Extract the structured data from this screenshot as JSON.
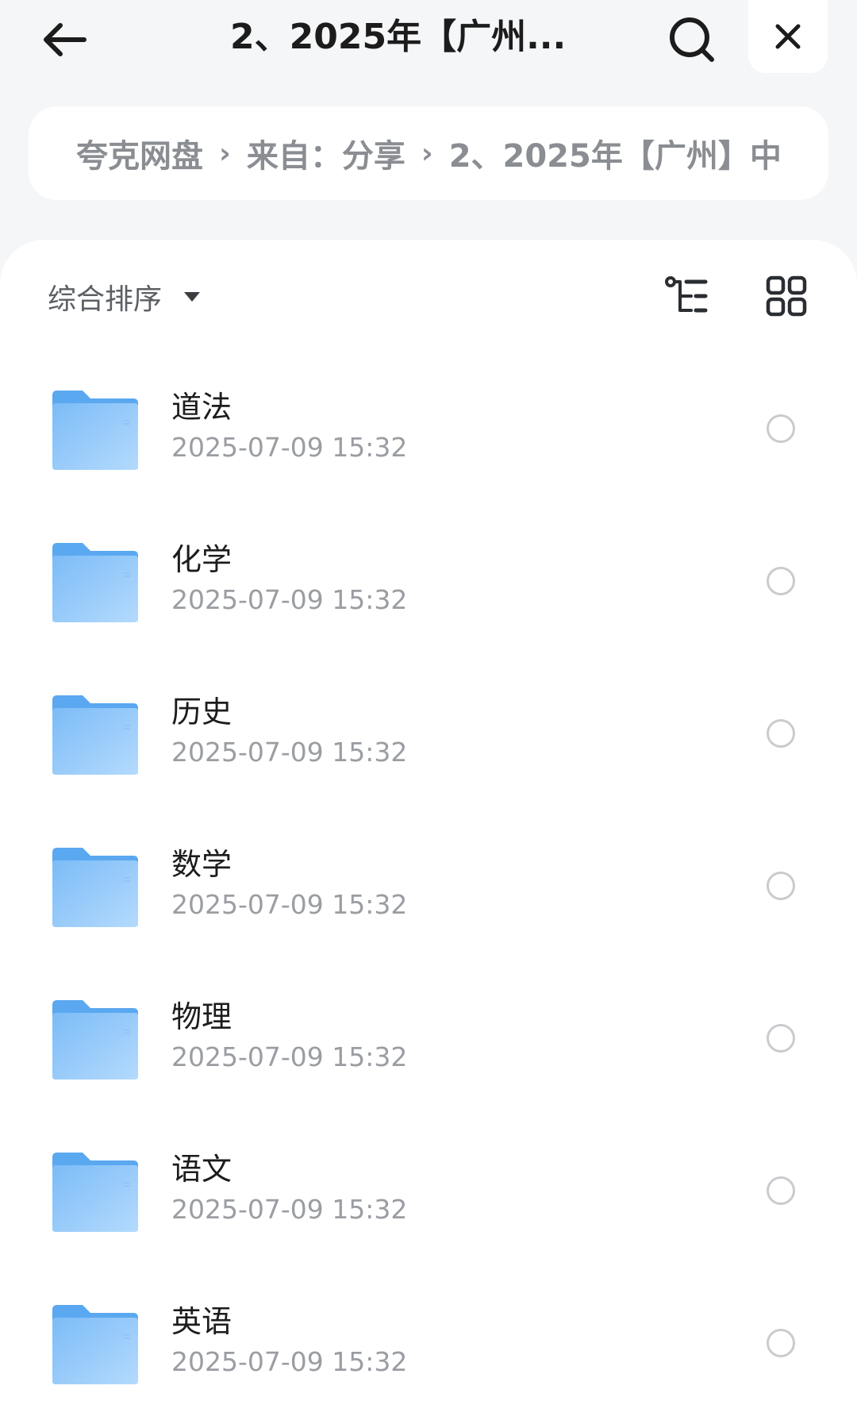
{
  "header": {
    "title": "2、2025年【广州...",
    "back_icon": "arrow-left-icon",
    "search_icon": "search-icon",
    "close_icon": "close-icon"
  },
  "breadcrumb": {
    "items": [
      {
        "label": "夸克网盘"
      },
      {
        "label": "来自：分享"
      },
      {
        "label": "2、2025年【广州】中"
      }
    ],
    "separator": "›"
  },
  "toolbar": {
    "sort_label": "综合排序",
    "sort_icon": "caret-down-icon",
    "tree_icon": "tree-view-icon",
    "grid_icon": "grid-view-icon"
  },
  "files": [
    {
      "name": "道法",
      "date": "2025-07-09 15:32",
      "type": "folder"
    },
    {
      "name": "化学",
      "date": "2025-07-09 15:32",
      "type": "folder"
    },
    {
      "name": "历史",
      "date": "2025-07-09 15:32",
      "type": "folder"
    },
    {
      "name": "数学",
      "date": "2025-07-09 15:32",
      "type": "folder"
    },
    {
      "name": "物理",
      "date": "2025-07-09 15:32",
      "type": "folder"
    },
    {
      "name": "语文",
      "date": "2025-07-09 15:32",
      "type": "folder"
    },
    {
      "name": "英语",
      "date": "2025-07-09 15:32",
      "type": "folder"
    }
  ],
  "colors": {
    "background": "#f5f6f7",
    "panel": "#ffffff",
    "folder_light": "#a9d3fb",
    "folder_dark": "#5aa8f0",
    "text_primary": "#1c1c1c",
    "text_secondary": "#9a9da2"
  }
}
